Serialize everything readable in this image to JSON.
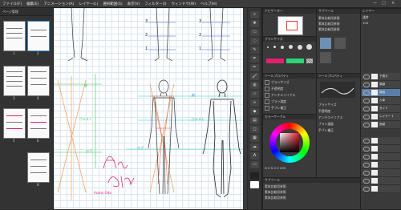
{
  "menu": [
    "ファイル(F)",
    "編集(E)",
    "アニメーション(A)",
    "レイヤー(L)",
    "選択範囲(S)",
    "表示(V)",
    "フィルター(I)",
    "ウィンドウ(W)",
    "ヘルプ(H)"
  ],
  "window_controls": [
    "—",
    "□",
    "×"
  ],
  "pages_panel": {
    "title": "ページ管理",
    "labels": [
      "1",
      "2",
      "3",
      "4",
      "5",
      "6",
      "7",
      "8"
    ]
  },
  "canvas": {
    "height_marks": [
      "3",
      "2",
      "1",
      "3",
      "2",
      "1"
    ],
    "annotations": [
      "ウエスト",
      "ウエスト",
      "ひざ",
      "ひざ",
      "肩",
      "肩"
    ],
    "signature": "Asami Oda"
  },
  "navigator": {
    "title": "ナビゲーター"
  },
  "brush_panel": {
    "title": "ブラシサイズ"
  },
  "color_panel": {
    "title": "カラーサークル",
    "hsv": [
      "H 0",
      "S 0",
      "V 100"
    ]
  },
  "tool_property": {
    "title": "ツールプロパティ",
    "rows": [
      "ブラシサイズ",
      "不透明度",
      "アンチエイリアス",
      "ブラシ濃度",
      "手ブレ補正"
    ]
  },
  "layer_panel": {
    "title": "レイヤー",
    "mode": "通常",
    "opacity": "100",
    "layers": [
      "下書き",
      "頭部",
      "線画",
      "人体",
      "ガイド",
      "レイヤー 1",
      "用紙"
    ]
  },
  "sub_tool": {
    "title": "サブツール",
    "items": [
      "素体比較用参照",
      "素体比較用参照",
      "素体比較用参照"
    ]
  },
  "colors": {
    "accent": "#5a7ea8",
    "swatch_pink": "#e0226e",
    "swatch_green": "#2fd17a"
  }
}
